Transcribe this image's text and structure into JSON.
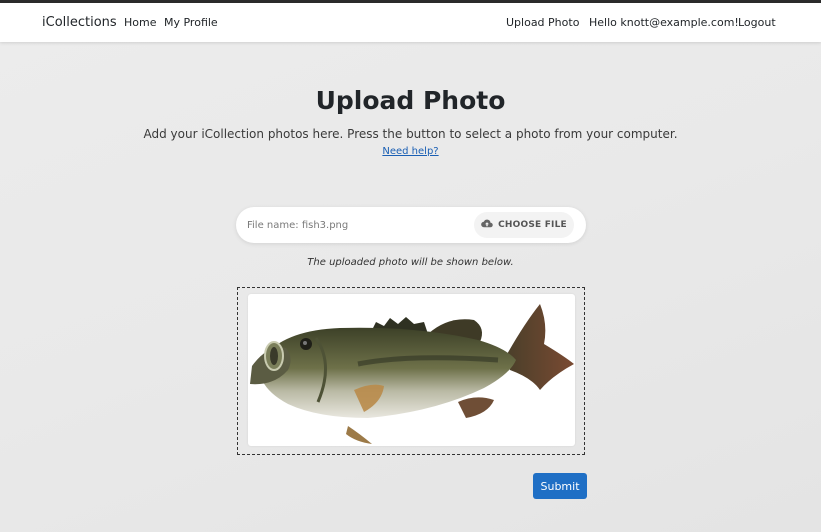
{
  "nav": {
    "brand": "iCollections",
    "home": "Home",
    "profile": "My Profile",
    "upload": "Upload Photo",
    "greeting": "Hello knott@example.com!",
    "logout": "Logout"
  },
  "page": {
    "title": "Upload Photo",
    "subtitle": "Add your iCollection photos here. Press the button to select a photo from your computer.",
    "help_link": "Need help?"
  },
  "upload": {
    "file_name": "File name: fish3.png",
    "choose_label": "CHOOSE FILE",
    "choose_icon": "cloud-upload-icon",
    "caption": "The uploaded photo will be shown below.",
    "preview_subject": "largemouth bass fish photo"
  },
  "form": {
    "submit_label": "Submit"
  },
  "colors": {
    "primary": "#1f6fc5",
    "link": "#1a5fb4",
    "navbar_bg": "#ffffff"
  }
}
